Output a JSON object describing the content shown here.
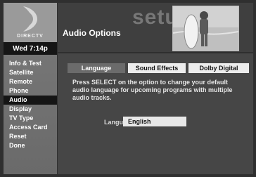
{
  "brand": {
    "name": "DIRECTV"
  },
  "clock": "Wed 7:14p",
  "sidebar": {
    "items": [
      {
        "label": "Info & Test"
      },
      {
        "label": "Satellite"
      },
      {
        "label": "Remote"
      },
      {
        "label": "Phone"
      },
      {
        "label": "Audio",
        "active": true
      },
      {
        "label": "Display"
      },
      {
        "label": "TV Type"
      },
      {
        "label": "Access Card"
      },
      {
        "label": "Reset"
      },
      {
        "label": "Done"
      }
    ]
  },
  "header": {
    "title": "Audio Options",
    "watermark": "setup"
  },
  "tabs": [
    {
      "label": "Language",
      "active": true
    },
    {
      "label": "Sound Effects"
    },
    {
      "label": "Dolby Digital"
    }
  ],
  "description": "Press SELECT on the option to change your default audio language for upcoming programs with multiple audio tracks.",
  "language": {
    "label": "Language :",
    "value": "English"
  }
}
